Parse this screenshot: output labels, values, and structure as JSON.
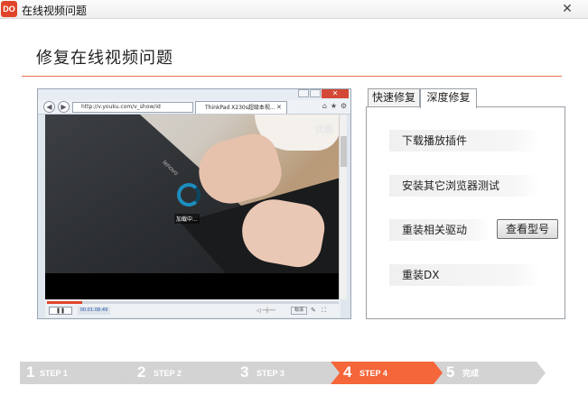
{
  "window": {
    "title": "在线视频问题",
    "logo_text": "DO",
    "close_label": "✕"
  },
  "header": {
    "page_title": "修复在线视频问题"
  },
  "browser": {
    "url": "http://v.youku.com/v_show/id",
    "tab_title": "ThinkPad X230s超级本视...",
    "video_watermark": "优酷",
    "loading_text": "加载中...",
    "laptop_brand": "lenovo",
    "time_text": "00:01:08:49",
    "quality_label": "标清",
    "progress_fraction": 0.12
  },
  "tabs": [
    {
      "label": "快速修复",
      "active": false
    },
    {
      "label": "深度修复",
      "active": true
    }
  ],
  "repair_options": [
    {
      "label": "下载播放插件"
    },
    {
      "label": "安装其它浏览器测试"
    },
    {
      "label": "重装相关驱动"
    },
    {
      "label": "重装DX"
    }
  ],
  "check_model_button": "查看型号",
  "steps": [
    {
      "num": "1",
      "label": "STEP 1",
      "active": false
    },
    {
      "num": "2",
      "label": "STEP 2",
      "active": false
    },
    {
      "num": "3",
      "label": "STEP  3",
      "active": false
    },
    {
      "num": "4",
      "label": "STEP  4",
      "active": true
    },
    {
      "num": "5",
      "label": "完成",
      "active": false
    }
  ],
  "colors": {
    "accent": "#f5663b",
    "step_inactive": "#d3d3d3",
    "logo": "#e0452a"
  }
}
